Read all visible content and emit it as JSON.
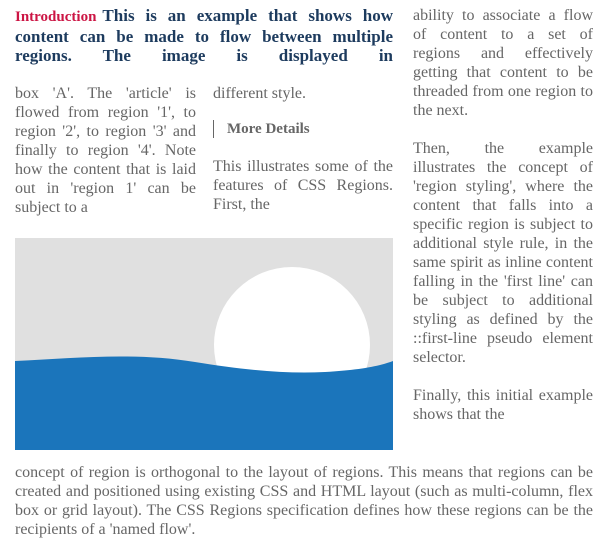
{
  "headline": {
    "label": "Introduction",
    "text": "This is an example that shows how content can be made to flow between multiple regions. The image is displayed in"
  },
  "region_1": {
    "text": "box 'A'. The 'article' is flowed from region '1', to region '2', to region '3' and finally to region '4'. Note how the content that is laid out in 'region 1' can be subject to a"
  },
  "region_2": {
    "continuation": "different style.",
    "subheading": "More Details",
    "text": "This illustrates some of the features of CSS Regions. First, the"
  },
  "region_3": {
    "paragraphs": [
      "ability to associate a flow of content to a set of regions and effectively getting that content to be threaded from one region to the next.",
      "Then, the example illustrates the concept of 'region styling', where the content that falls into a specific region is subject to additional style rule, in the same spirit as inline content falling in the 'first line' can be subject to additional styling as defined by the ::first-line pseudo element selector.",
      "Finally, this initial example shows that the"
    ]
  },
  "region_4": {
    "text": "concept of region is orthogonal to the layout of regions. This means that regions can be created and positioned using existing CSS and HTML layout (such as multi-column, flex box or grid layout). The CSS Regions specification defines how these regions can be the recipients of a 'named flow'."
  },
  "figure": {
    "description": "sun setting over the sea illustration",
    "colors": {
      "sky": "#e0e0e0",
      "sun": "#ffffff",
      "sea": "#1b75bb"
    }
  },
  "colors": {
    "intro_label": "#cc1544",
    "headline": "#1d3b5e",
    "body_text": "#666666"
  }
}
